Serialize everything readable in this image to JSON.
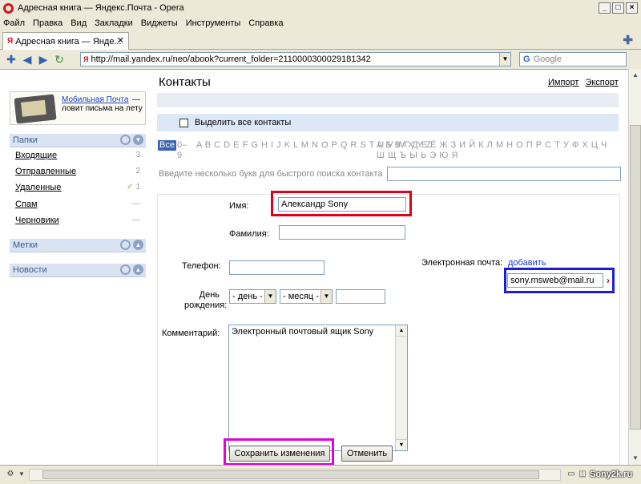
{
  "window": {
    "title": "Адресная книга — Яндекс.Почта - Opera"
  },
  "menu": [
    "Файл",
    "Правка",
    "Вид",
    "Закладки",
    "Виджеты",
    "Инструменты",
    "Справка"
  ],
  "tab": {
    "label": "Адресная книга — Янде...",
    "favicon": "Я"
  },
  "address": {
    "url": "http://mail.yandex.ru/neo/abook?current_folder=2110000300029181342"
  },
  "search": {
    "placeholder": "Google"
  },
  "promo": {
    "link": "Мобильная Почта",
    "text": "ловит письма на лету",
    "dash": "—"
  },
  "sidebar": {
    "folders_title": "Папки",
    "folders": [
      {
        "label": "Входящие",
        "count": "3"
      },
      {
        "label": "Отправленные",
        "count": "2"
      },
      {
        "label": "Удаленные",
        "count": "1"
      },
      {
        "label": "Спам",
        "count": "—"
      },
      {
        "label": "Черновики",
        "count": "—"
      }
    ],
    "labels_title": "Метки",
    "news_title": "Новости"
  },
  "page": {
    "title": "Контакты",
    "import": "Импорт",
    "export": "Экспорт",
    "select_all": "Выделить все контакты",
    "all": "Все",
    "digits": "0–9",
    "latin": "A B C D E F G H I J K L M N O P Q R S T U V W X Y Z",
    "cyrillic": "А Б В Г Д Е Ё Ж З И Й К Л М Н О П Р С Т У Ф Х Ц Ч Ш Щ Ъ Ы Ь Э Ю Я",
    "quick_search": "Введите несколько букв для быстрого поиска контакта"
  },
  "form": {
    "name_label": "Имя:",
    "name_value": "Александр Sony",
    "surname_label": "Фамилия:",
    "surname_value": "",
    "phone_label": "Телефон:",
    "email_label": "Электронная почта:",
    "email_add": "добавить",
    "email_value": "sony.msweb@mail.ru",
    "birthday_label_1": "День",
    "birthday_label_2": "рождения:",
    "day_select": "- день -",
    "month_select": "- месяц -",
    "comment_label": "Комментарий:",
    "comment_value": "Электронный почтовый ящик Sony",
    "save": "Сохранить изменения",
    "cancel": "Отменить"
  },
  "status": {
    "watermark": "Sony2k.ru"
  },
  "colors": {
    "highlight_name": "#e0001a",
    "highlight_email": "#1d1dd6",
    "highlight_save": "#e000e0"
  }
}
